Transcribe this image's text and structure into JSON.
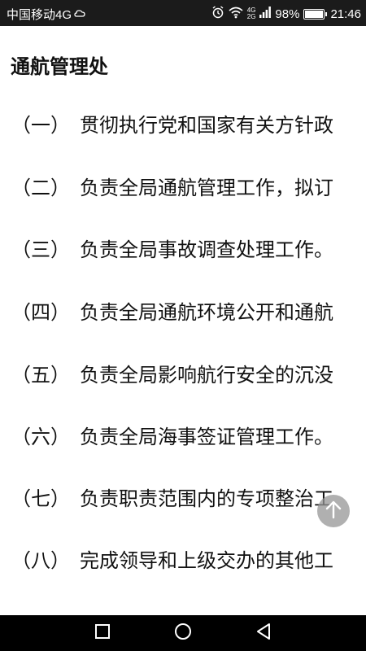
{
  "status_bar": {
    "carrier": "中国移动4G",
    "network_top": "4G",
    "network_bottom": "2G",
    "battery": "98%",
    "battery_level": 0.98,
    "time": "21:46"
  },
  "page_title": "通航管理处",
  "items": [
    {
      "num": "（一）",
      "text": "贯彻执行党和国家有关方针政"
    },
    {
      "num": "（二）",
      "text": "负责全局通航管理工作，拟订"
    },
    {
      "num": "（三）",
      "text": "负责全局事故调查处理工作。"
    },
    {
      "num": "（四）",
      "text": "负责全局通航环境公开和通航"
    },
    {
      "num": "（五）",
      "text": "负责全局影响航行安全的沉没"
    },
    {
      "num": "（六）",
      "text": "负责全局海事签证管理工作。"
    },
    {
      "num": "（七）",
      "text": "负责职责范围内的专项整治工"
    },
    {
      "num": "（八）",
      "text": "完成领导和上级交办的其他工"
    }
  ],
  "icons": {
    "scroll_top": "arrow-up-icon",
    "nav_recent": "square-icon",
    "nav_home": "circle-icon",
    "nav_back": "triangle-back-icon"
  },
  "colors": {
    "status_bar_bg": "#1b1b1b",
    "nav_bar_bg": "#000000",
    "text": "#111111",
    "page_bg": "#ffffff"
  }
}
